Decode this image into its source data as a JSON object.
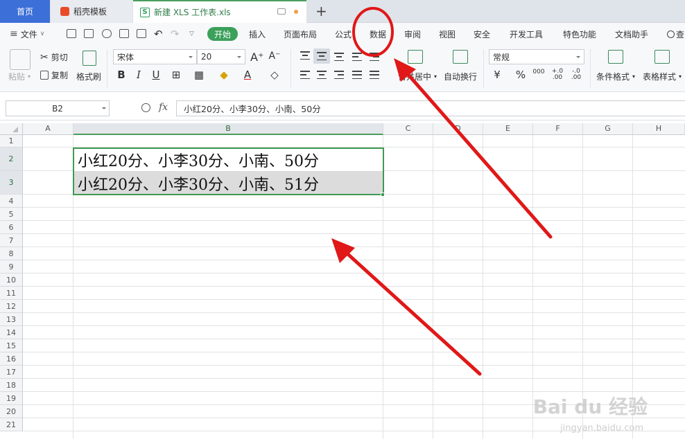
{
  "tabs": {
    "home": "首页",
    "docer": "稻壳模板",
    "file": "新建 XLS 工作表.xls",
    "new_tab": "+"
  },
  "menu": {
    "file": "文件",
    "items": [
      "开始",
      "插入",
      "页面布局",
      "公式",
      "数据",
      "审阅",
      "视图",
      "安全",
      "开发工具",
      "特色功能",
      "文档助手",
      "查"
    ]
  },
  "ribbon": {
    "paste": "粘贴",
    "cut": "剪切",
    "copy": "复制",
    "format_painter": "格式刷",
    "font_name": "宋体",
    "font_size": "20",
    "merge": "合并居中",
    "wrap": "自动换行",
    "number_format": "常规",
    "cond_format": "条件格式",
    "table_style": "表格样式"
  },
  "formula_bar": {
    "cell_ref": "B2",
    "fx": "fx",
    "content": "小红20分、小李30分、小南、50分"
  },
  "sheet": {
    "columns": [
      "A",
      "B",
      "C",
      "D",
      "E",
      "F",
      "G",
      "H"
    ],
    "rows": [
      "1",
      "2",
      "3",
      "4",
      "5",
      "6",
      "7",
      "8",
      "9",
      "10",
      "11",
      "12",
      "13",
      "14",
      "15",
      "16",
      "17",
      "18",
      "19",
      "20",
      "21"
    ],
    "b2": "小红20分、小李30分、小南、50分",
    "b3": "小红20分、小李30分、小南、51分"
  },
  "watermark": {
    "brand": "Bai du 经验",
    "url": "jingyan.baidu.com"
  },
  "colors": {
    "accent": "#3ba05a",
    "annotation": "#e01818",
    "home_tab": "#3d6fd8"
  }
}
